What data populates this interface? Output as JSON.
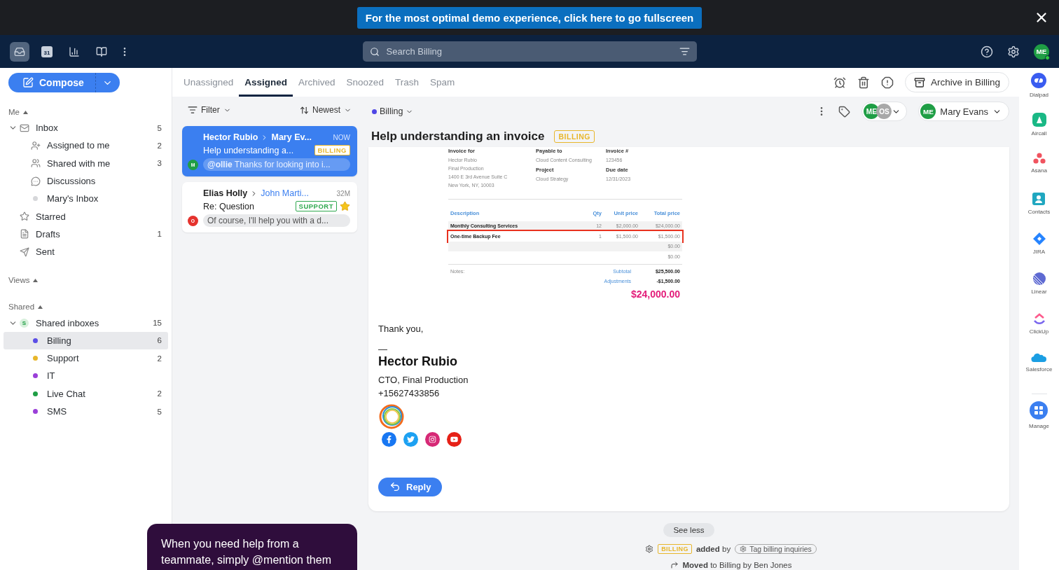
{
  "banner": {
    "text": "For the most optimal demo experience, click here to go fullscreen"
  },
  "appbar": {
    "nav": [
      {
        "kind": "inbox",
        "selected": true
      },
      {
        "kind": "calendar",
        "label": "31",
        "selected": false
      },
      {
        "kind": "analytics",
        "selected": false
      },
      {
        "kind": "panels",
        "selected": false
      }
    ],
    "search_placeholder": "Search Billing",
    "avatar": "ME"
  },
  "sidebar": {
    "compose": "Compose",
    "sections": [
      {
        "title": "Me",
        "expanded": true,
        "items": [
          {
            "label": "Inbox",
            "count": "5",
            "kind": "inbox",
            "expanded": true,
            "selected": false,
            "children": [
              {
                "label": "Assigned to me",
                "count": "2",
                "kind": "assign",
                "selected": false
              },
              {
                "label": "Shared with me",
                "count": "3",
                "kind": "shared",
                "selected": false
              },
              {
                "label": "Discussions",
                "kind": "chat",
                "selected": false
              },
              {
                "label": "Mary's Inbox",
                "kind": "dot",
                "selected": false
              }
            ]
          },
          {
            "label": "Starred",
            "kind": "star",
            "selected": false
          },
          {
            "label": "Drafts",
            "count": "1",
            "kind": "draft",
            "selected": false
          },
          {
            "label": "Sent",
            "kind": "sent",
            "selected": false
          }
        ]
      },
      {
        "title": "Views",
        "expanded": true
      },
      {
        "title": "Shared",
        "expanded": true,
        "items": [
          {
            "label": "Shared inboxes",
            "count": "15",
            "kind": "badge",
            "badge": "S",
            "expanded": true,
            "selected": false,
            "children": [
              {
                "label": "Billing",
                "count": "6",
                "kind": "channel",
                "color": "#5b4ee6",
                "selected": true
              },
              {
                "label": "Support",
                "count": "2",
                "kind": "channel",
                "color": "#e8b62a",
                "selected": false
              },
              {
                "label": "IT",
                "kind": "channel",
                "color": "#9a3fd8",
                "selected": false
              },
              {
                "label": "Live Chat",
                "count": "2",
                "kind": "channel",
                "color": "#1f9e45",
                "selected": false
              },
              {
                "label": "SMS",
                "count": "5",
                "kind": "channel",
                "color": "#9a3fd8",
                "selected": false
              }
            ]
          }
        ]
      }
    ]
  },
  "tabs": [
    {
      "label": "Unassigned",
      "selected": false
    },
    {
      "label": "Assigned",
      "selected": true
    },
    {
      "label": "Archived",
      "selected": false
    },
    {
      "label": "Snoozed",
      "selected": false
    },
    {
      "label": "Trash",
      "selected": false
    },
    {
      "label": "Spam",
      "selected": false
    }
  ],
  "archive_button": "Archive in Billing",
  "list": {
    "filter": "Filter",
    "sort": "Newest",
    "conversations": [
      {
        "from": "Hector Rubio",
        "to": "Mary Ev...",
        "time": "NOW",
        "subject": "Help understanding a...",
        "tag": {
          "label": "BILLING",
          "color": "#e8b62a"
        },
        "avatar": {
          "letter": "M",
          "color": "#1f9e45"
        },
        "preview": "**@ollie** Thanks for looking into i...",
        "selected": true,
        "starred": false
      },
      {
        "from": "Elias Holly",
        "to": "John Marti...",
        "time": "32M",
        "subject": "Re: Question",
        "tag": {
          "label": "SUPPORT",
          "color": "#2fa84f"
        },
        "avatar": {
          "letter": "O",
          "color": "#e5322d"
        },
        "preview": "Of course, I'll help you with a d...",
        "selected": false,
        "starred": true
      }
    ]
  },
  "conversation": {
    "inbox": {
      "label": "Billing",
      "color": "#4f46e5"
    },
    "assignees": [
      {
        "initials": "ME",
        "color": "#1f9e45"
      },
      {
        "initials": "OS",
        "color": "#a8a8a8"
      }
    ],
    "assignee": {
      "initials": "ME",
      "name": "Mary Evans"
    },
    "title": "Help understanding an invoice",
    "tag": "BILLING",
    "invoice": {
      "columns": [
        [
          {
            "heading": "Invoice for",
            "lines": [
              "Hector Rubio",
              "Final Production",
              "1400 E 3rd Avenue Suite C",
              "New York, NY, 10003"
            ]
          }
        ],
        [
          {
            "heading": "Payable to",
            "lines": [
              "Cloud Content Consulting"
            ]
          },
          {
            "heading": "Project",
            "lines": [
              "Cloud Strategy"
            ]
          }
        ],
        [
          {
            "heading": "Invoice #",
            "lines": [
              "123456"
            ]
          },
          {
            "heading": "Due date",
            "lines": [
              "12/31/2023"
            ]
          }
        ]
      ],
      "table_columns": [
        "Description",
        "Qty",
        "Unit price",
        "Total price"
      ],
      "rows": [
        {
          "description": "Monthly Consulting Services",
          "qty": "12",
          "unit": "$2,000.00",
          "total": "$24,000.00",
          "highlighted": false
        },
        {
          "description": "One-time Backup Fee",
          "qty": "1",
          "unit": "$1,500.00",
          "total": "$1,500.00",
          "highlighted": true
        },
        {
          "total": "$0.00",
          "highlighted": false
        },
        {
          "total": "$0.00",
          "highlighted": false
        }
      ],
      "notes": "Notes:",
      "totals": [
        {
          "label": "Subtotal",
          "value": "$25,500.00"
        },
        {
          "label": "Adjustments",
          "value": "-$1,500.00"
        }
      ],
      "grand_total": "$24,000.00"
    },
    "closing": "Thank you,",
    "dash": "—",
    "signature": {
      "name": "Hector Rubio",
      "lines": [
        "CTO, Final Production",
        "+15627433856"
      ]
    },
    "socials": [
      {
        "kind": "facebook"
      },
      {
        "kind": "twitter"
      },
      {
        "kind": "instagram"
      },
      {
        "kind": "youtube"
      }
    ],
    "reply": "Reply",
    "see_less": "See less",
    "activity": {
      "tag": "BILLING",
      "text": "**added** by",
      "rule": "Tag billing inquiries",
      "moved": "**Moved** to Billing by Ben Jones"
    }
  },
  "rail": [
    {
      "kind": "dialpad",
      "label": "Dialpad"
    },
    {
      "kind": "aircall",
      "label": "Aircall"
    },
    {
      "kind": "asana",
      "label": "Asana"
    },
    {
      "kind": "contacts",
      "label": "Contacts"
    },
    {
      "kind": "jira",
      "label": "JIRA"
    },
    {
      "kind": "linear",
      "label": "Linear"
    },
    {
      "kind": "clickup",
      "label": "ClickUp"
    },
    {
      "kind": "salesforce",
      "label": "Salesforce"
    },
    {
      "kind": "manage",
      "label": "Manage"
    }
  ],
  "tooltip": "When you need help from a teammate, simply @mention them"
}
